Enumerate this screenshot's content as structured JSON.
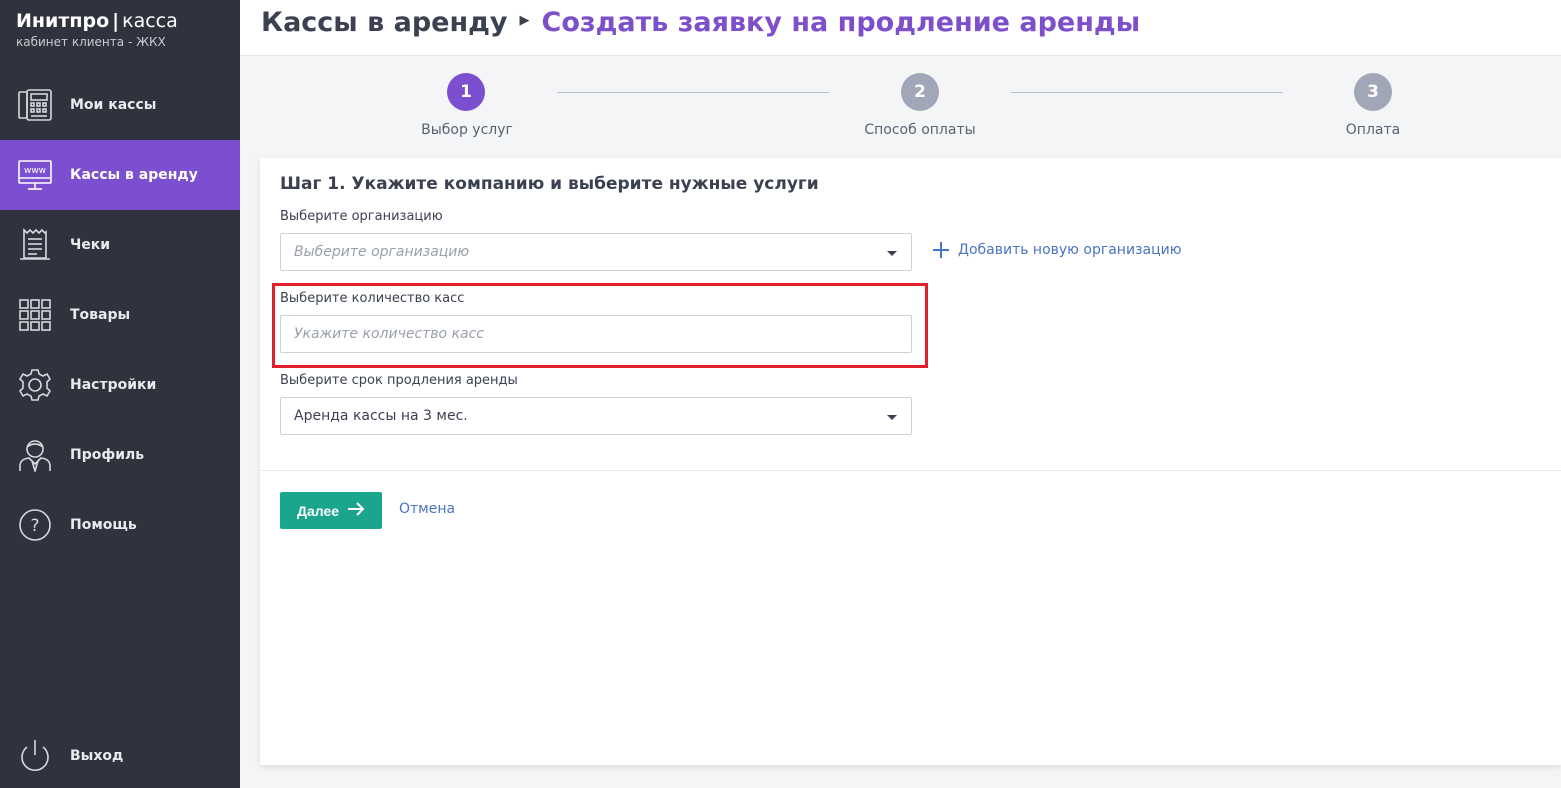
{
  "brand": {
    "name_bold": "Инитпро",
    "separator": "|",
    "name_light": "касса",
    "subtitle": "кабинет клиента - ЖКХ"
  },
  "sidebar": {
    "items": [
      {
        "label": "Мои кассы",
        "icon": "cash-register-icon"
      },
      {
        "label": "Кассы в аренду",
        "icon": "monitor-www-icon",
        "active": true
      },
      {
        "label": "Чеки",
        "icon": "receipt-icon"
      },
      {
        "label": "Товары",
        "icon": "grid-icon"
      },
      {
        "label": "Настройки",
        "icon": "gear-icon"
      },
      {
        "label": "Профиль",
        "icon": "user-icon"
      },
      {
        "label": "Помощь",
        "icon": "help-icon"
      }
    ],
    "logout": {
      "label": "Выход",
      "icon": "power-icon"
    }
  },
  "header": {
    "breadcrumb_root": "Кассы в аренду",
    "breadcrumb_current": "Создать заявку на продление аренды"
  },
  "stepper": {
    "steps": [
      {
        "number": "1",
        "label": "Выбор услуг",
        "active": true
      },
      {
        "number": "2",
        "label": "Способ оплаты",
        "active": false
      },
      {
        "number": "3",
        "label": "Оплата",
        "active": false
      }
    ]
  },
  "form": {
    "title": "Шаг 1. Укажите компанию и выберите нужные услуги",
    "org_label": "Выберите организацию",
    "org_placeholder": "Выберите организацию",
    "add_org_label": "Добавить новую организацию",
    "qty_label": "Выберите количество касс",
    "qty_placeholder": "Укажите количество касс",
    "term_label": "Выберите срок продления аренды",
    "term_value": "Аренда кассы на 3 мес.",
    "next_label": "Далее",
    "cancel_label": "Отмена"
  },
  "colors": {
    "sidebar_bg": "#30333d",
    "accent_purple": "#7c4fd1",
    "breadcrumb_purple": "#7e4fcb",
    "primary_button": "#1aa58c",
    "link": "#4a74c4",
    "highlight": "#e01f2b"
  }
}
